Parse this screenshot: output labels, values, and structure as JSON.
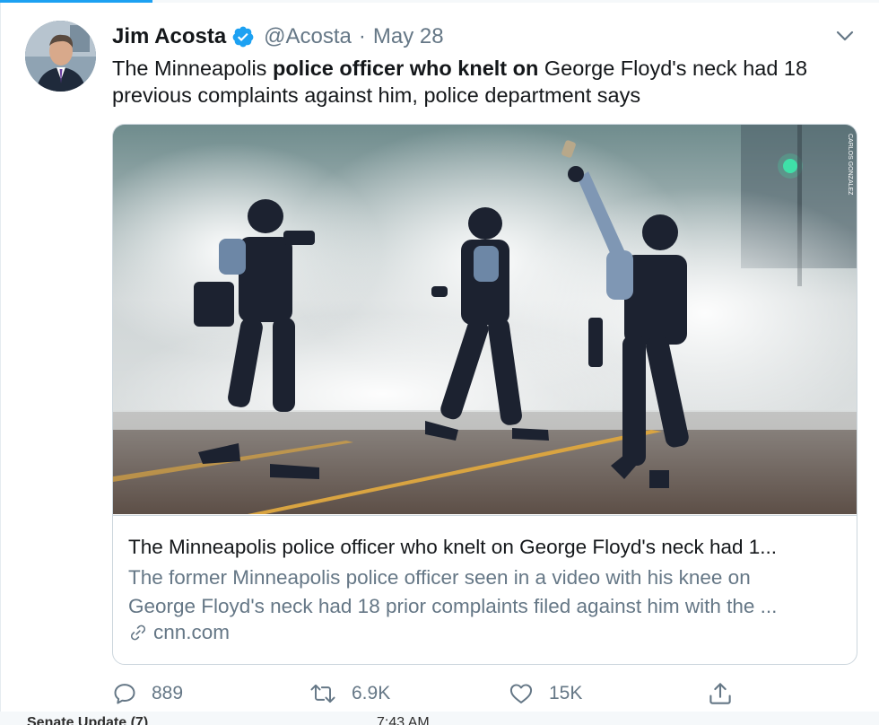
{
  "tweet": {
    "author_name": "Jim Acosta",
    "handle": "@Acosta",
    "separator": "·",
    "date": "May 28",
    "text_pre": "The Minneapolis ",
    "text_bold_1": "police officer who knelt on",
    "text_post": " George Floyd's neck had 18 previous complaints against him, police department says",
    "photo_credit": "CARLOS GONZALEZ"
  },
  "card": {
    "title": "The Minneapolis police officer who knelt on George Floyd's neck had 1...",
    "description_line1": "The former Minneapolis police officer seen in a video with his knee on",
    "description_line2": "George Floyd's neck had 18 prior complaints filed against him with the ...",
    "domain": "cnn.com"
  },
  "actions": {
    "reply_count": "889",
    "retweet_count": "6.9K",
    "like_count": "15K"
  },
  "background_strip": {
    "left_text": "Senate Update (7)",
    "right_text": "7:43 AM"
  },
  "colors": {
    "accent": "#1da1f2",
    "secondary_text": "#657786",
    "border": "#ccd6dd"
  },
  "icons": [
    "verified-badge-icon",
    "chevron-down-icon",
    "reply-icon",
    "retweet-icon",
    "like-icon",
    "share-icon",
    "link-icon"
  ]
}
